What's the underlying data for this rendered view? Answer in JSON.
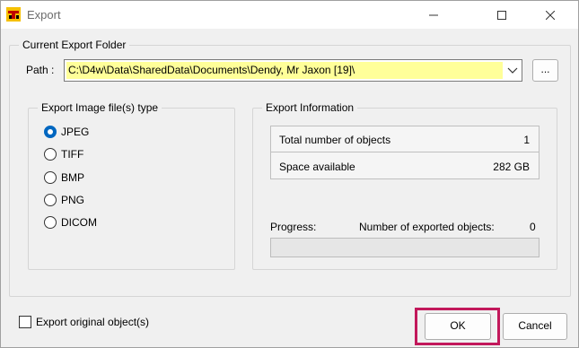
{
  "window": {
    "title": "Export",
    "controls": {
      "minimize": "minimize",
      "maximize": "maximize",
      "close": "close"
    }
  },
  "export_folder": {
    "group_label": "Current Export Folder",
    "path_label": "Path :",
    "path_value": "C:\\D4w\\Data\\SharedData\\Documents\\Dendy, Mr Jaxon [19]\\",
    "browse_label": "..."
  },
  "image_type": {
    "group_label": "Export Image file(s) type",
    "options": [
      {
        "label": "JPEG",
        "checked": true
      },
      {
        "label": "TIFF",
        "checked": false
      },
      {
        "label": "BMP",
        "checked": false
      },
      {
        "label": "PNG",
        "checked": false
      },
      {
        "label": "DICOM",
        "checked": false
      }
    ]
  },
  "export_info": {
    "group_label": "Export Information",
    "rows": [
      {
        "name": "Total number of objects",
        "value": "1"
      },
      {
        "name": "Space available",
        "value": "282 GB"
      }
    ],
    "progress_label": "Progress:",
    "count_label": "Number of exported objects:",
    "count_value": "0",
    "progress_fraction": 0
  },
  "footer": {
    "export_original_label": "Export original object(s)",
    "export_original_checked": false,
    "ok_label": "OK",
    "cancel_label": "Cancel"
  },
  "colors": {
    "highlight": "#c2185b",
    "path_background": "#ffff99",
    "accent": "#0067c0"
  },
  "icons": {
    "app": "app-logo-icon",
    "dropdown": "chevron-down-icon"
  }
}
